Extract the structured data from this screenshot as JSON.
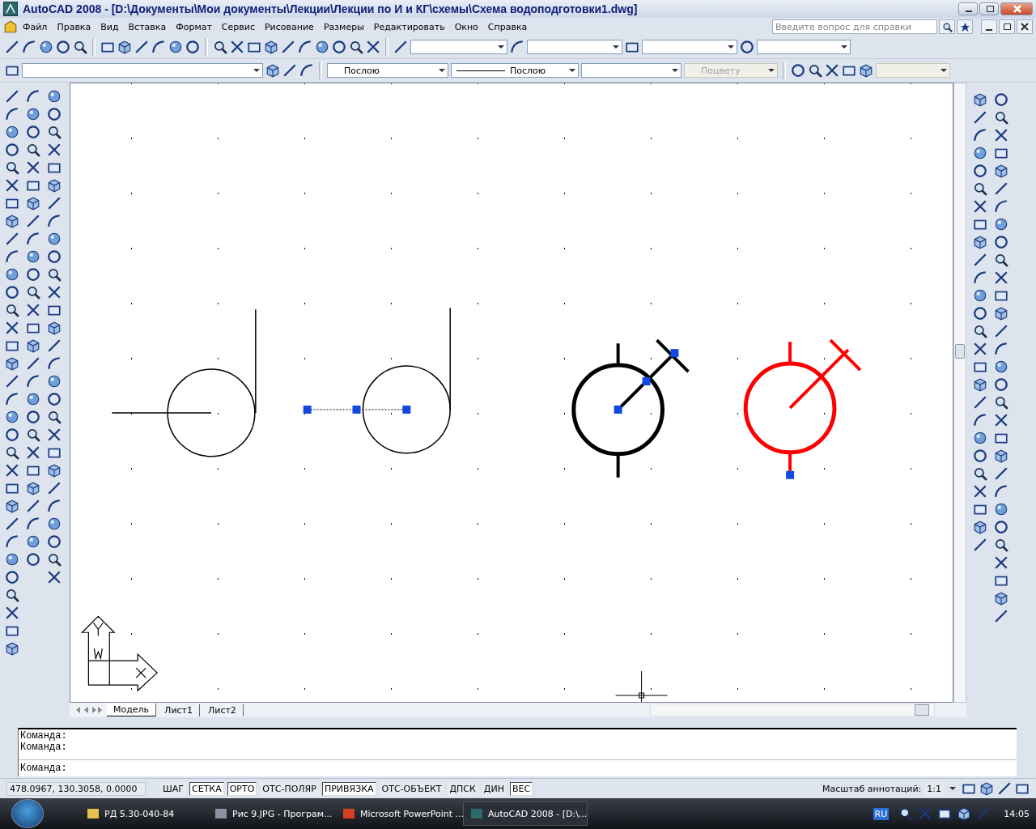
{
  "window": {
    "title": "AutoCAD 2008 - [D:\\Документы\\Мои документы\\Лекции\\Лекции по И и КГ\\схемы\\Схема водоподготовки1.dwg]"
  },
  "menu": [
    "Файл",
    "Правка",
    "Вид",
    "Вставка",
    "Формат",
    "Сервис",
    "Рисование",
    "Размеры",
    "Редактировать",
    "Окно",
    "Справка"
  ],
  "help_search": {
    "placeholder": "Введите вопрос для справки"
  },
  "properties_toolbar": {
    "color_setting": "Послою",
    "linetype": "Послою",
    "plot_style": {
      "value": "Поцвету",
      "disabled": true
    }
  },
  "layout_tabs": [
    {
      "label": "Модель",
      "selected": true
    },
    {
      "label": "Лист1",
      "selected": false
    },
    {
      "label": "Лист2",
      "selected": false
    }
  ],
  "command_history": [
    "Команда:",
    "Команда:"
  ],
  "command_prompt": "Команда:",
  "status_bar": {
    "coordinates": "478.0967, 130.3058, 0.0000",
    "toggles": [
      {
        "label": "ШАГ",
        "on": false
      },
      {
        "label": "СЕТКА",
        "on": true
      },
      {
        "label": "ОРТО",
        "on": true
      },
      {
        "label": "ОТС-ПОЛЯР",
        "on": false
      },
      {
        "label": "ПРИВЯЗКА",
        "on": true
      },
      {
        "label": "ОТС-ОБЪЕКТ",
        "on": false
      },
      {
        "label": "ДПСК",
        "on": false
      },
      {
        "label": "ДИН",
        "on": false
      },
      {
        "label": "ВЕС",
        "on": true
      }
    ],
    "annotation_scale_label": "Масштаб аннотаций:",
    "annotation_scale": "1:1"
  },
  "taskbar": {
    "items": [
      {
        "label": "РД 5.30-040-84",
        "selected": false
      },
      {
        "label": "Рис 9.JPG - Програм...",
        "selected": false
      },
      {
        "label": "Microsoft PowerPoint ...",
        "selected": false
      },
      {
        "label": "AutoCAD 2008 - [D:\\...",
        "selected": true
      }
    ],
    "language": "RU",
    "clock": "14:05"
  }
}
